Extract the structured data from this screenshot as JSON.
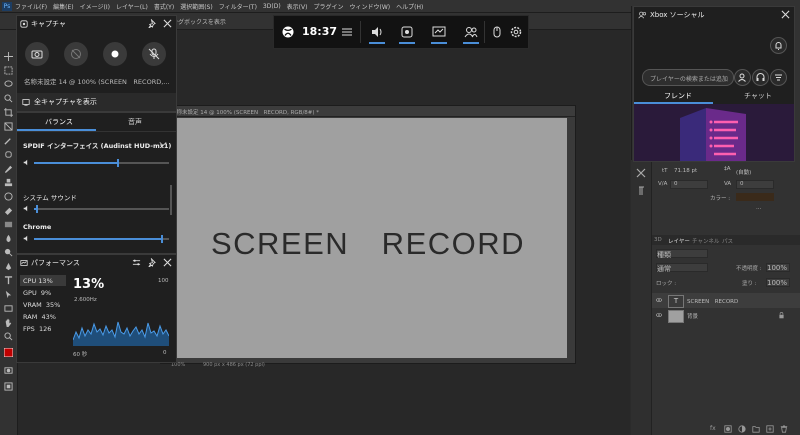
{
  "photoshop": {
    "logo": "Ps",
    "menu": [
      "ファイル(F)",
      "編集(E)",
      "イメージ(I)",
      "レイヤー(L)",
      "書式(Y)",
      "選択範囲(S)",
      "フィルター(T)",
      "3D(D)",
      "表示(V)",
      "プラグイン",
      "ウィンドウ(W)",
      "ヘルプ(H)"
    ],
    "options_label": "ングボックスを表示",
    "document_tab": "名称未設定 14 @ 100% (SCREEN　RECORD, RGB/8#) *",
    "canvas_text": "SCREEN　RECORD",
    "zoom": "100%",
    "doc_size": "900 px x 486 px (72 ppi)",
    "properties": {
      "font_size": "71.18 pt",
      "leading": "(自動)",
      "va": "0",
      "tracking": "0",
      "color_label": "カラー :",
      "text_color": "#3a2a1a"
    },
    "layers": {
      "tabs": [
        "3D",
        "レイヤー",
        "チャンネル",
        "パス"
      ],
      "filter": "種類",
      "blend_mode": "通常",
      "opacity_label": "不透明度 :",
      "opacity": "100%",
      "lock_label": "ロック :",
      "fill_label": "塗り :",
      "fill": "100%",
      "items": [
        {
          "name": "SCREEN　RECORD",
          "thumb": "T"
        },
        {
          "name": "背景",
          "thumb": ""
        }
      ]
    }
  },
  "gamebar": {
    "time": "18:37",
    "widgets": [
      "audio-icon",
      "capture-icon",
      "performance-icon",
      "xbox-social-icon"
    ],
    "accent": "#4a8ed8"
  },
  "capture": {
    "title": "キャプチャ",
    "info": "名称未設定 14 @ 100% (SCREEN　RECORD,...",
    "show_all": "全キャプチャを表示"
  },
  "audio": {
    "tabs": [
      "バランス",
      "音声"
    ],
    "device": "SPDIF インターフェイス (Audinst HUD-mx1)",
    "device_level": 0.62,
    "system_label": "システム サウンド",
    "system_level": 0.02,
    "app_label": "Chrome",
    "app_level": 0.95
  },
  "performance": {
    "title": "パフォーマンス",
    "stats": [
      {
        "label": "CPU",
        "value": "13%"
      },
      {
        "label": "GPU",
        "value": "9%"
      },
      {
        "label": "VRAM",
        "value": "35%"
      },
      {
        "label": "RAM",
        "value": "43%"
      },
      {
        "label": "FPS",
        "value": "126"
      }
    ],
    "big_value": "13%",
    "freq": "2.600Hz",
    "max_label": "100",
    "min_label": "0",
    "time_label": "60 秒"
  },
  "social": {
    "title": "Xbox ソーシャル",
    "search_placeholder": "プレイヤーの検索または追加",
    "tabs": [
      "フレンド",
      "チャット"
    ]
  }
}
